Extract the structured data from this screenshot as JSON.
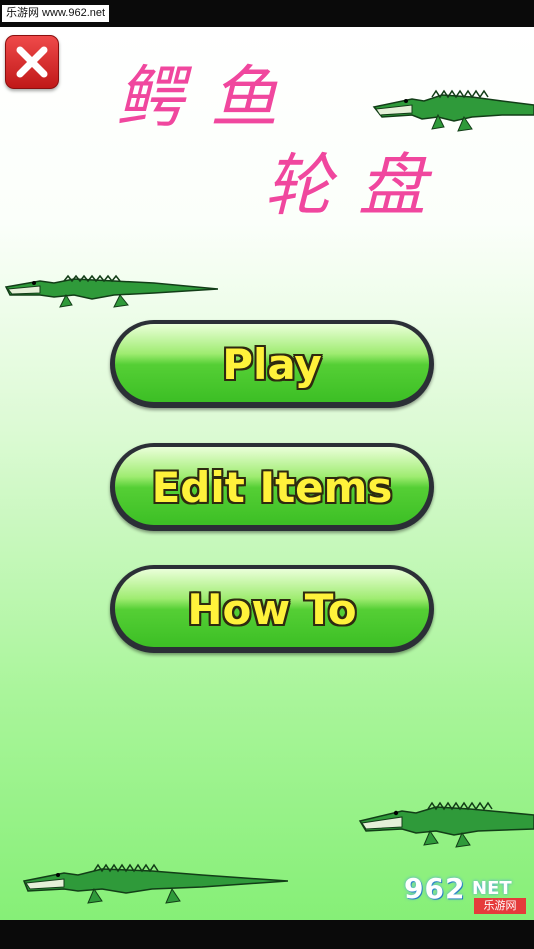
{
  "status_bar": {
    "watermark_text": "乐游网 www.962.net"
  },
  "app": {
    "title_line1": "鳄鱼",
    "title_line2": "轮盘",
    "close_icon": "close-x-icon"
  },
  "menu": {
    "play_label": "Play",
    "edit_items_label": "Edit Items",
    "how_to_label": "How To"
  },
  "footer_logo": {
    "number": "962",
    "suffix": "NET",
    "site_name": "乐游网"
  },
  "colors": {
    "title_pink": "#f0479e",
    "button_green": "#55cf35",
    "button_text_yellow": "#fff23b",
    "close_red": "#d92a2a"
  }
}
